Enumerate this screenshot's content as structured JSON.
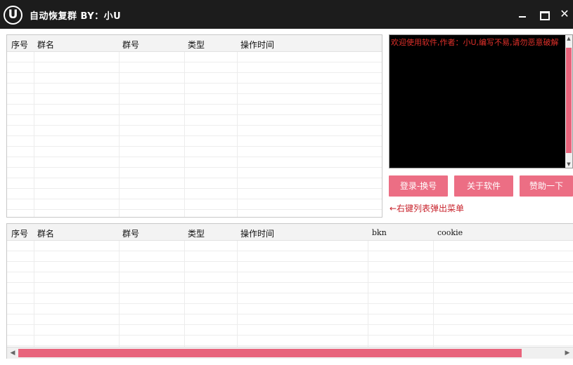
{
  "window": {
    "logo_letter": "U",
    "title": "自动恢复群 BY：小U",
    "minimize_label": "",
    "maximize_label": "",
    "close_label": "✕"
  },
  "top_table": {
    "columns": [
      "序号",
      "群名",
      "群号",
      "类型",
      "操作时间"
    ]
  },
  "bottom_table": {
    "columns": [
      "序号",
      "群名",
      "群号",
      "类型",
      "操作时间",
      "bkn",
      "cookie"
    ]
  },
  "console": {
    "log_text": "欢迎使用软件,作者：小U,编写不易,请勿恶意破解"
  },
  "buttons": {
    "login": "登录-换号",
    "about": "关于软件",
    "donate": "赞助一下"
  },
  "hint": "←右键列表弹出菜单",
  "colors": {
    "accent": "#ec6e84",
    "titlebar": "#1c1c1c",
    "console_bg": "#000000",
    "console_text": "#e0302a",
    "hint_text": "#c8232c"
  }
}
